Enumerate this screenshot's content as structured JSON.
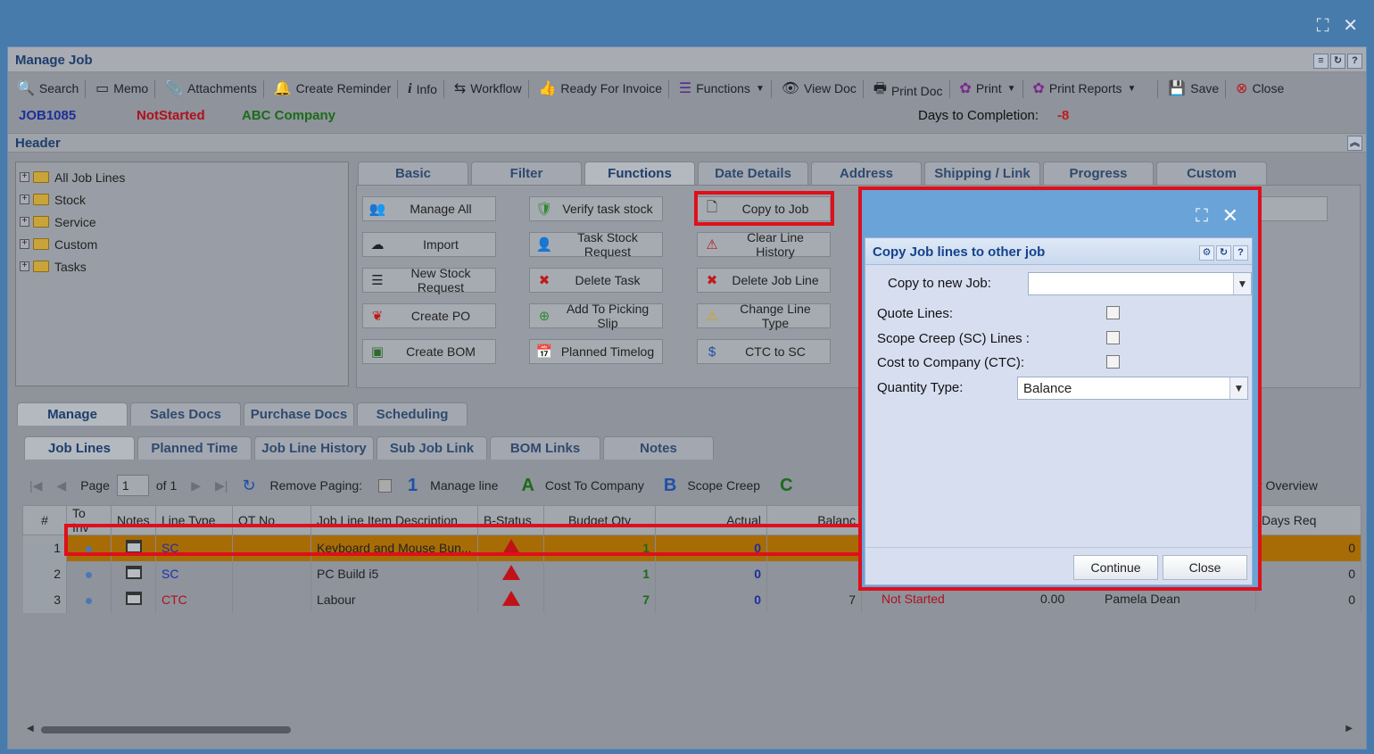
{
  "window": {
    "title": "Manage Job"
  },
  "toolbar": [
    {
      "label": "Search",
      "icon": "search-icon"
    },
    {
      "label": "Memo",
      "icon": "memo-icon"
    },
    {
      "label": "Attachments",
      "icon": "paperclip-icon"
    },
    {
      "label": "Create Reminder",
      "icon": "bell-icon"
    },
    {
      "label": "Info",
      "icon": "info-icon"
    },
    {
      "label": "Workflow",
      "icon": "workflow-icon"
    },
    {
      "label": "Ready For Invoice",
      "icon": "thumbs-up-icon"
    },
    {
      "label": "Functions",
      "icon": "menu-icon",
      "dropdown": true
    },
    {
      "label": "View Doc",
      "icon": "eye-icon"
    },
    {
      "label": "Print Doc",
      "icon": "printer-icon"
    },
    {
      "label": "Print",
      "icon": "print-gear-icon",
      "dropdown": true
    },
    {
      "label": "Print Reports",
      "icon": "print-reports-icon",
      "dropdown": true
    },
    {
      "label": "Save",
      "icon": "floppy-icon"
    },
    {
      "label": "Close",
      "icon": "close-circle-icon"
    }
  ],
  "job": {
    "number": "JOB1085",
    "status": "NotStarted",
    "company": "ABC Company",
    "days_label": "Days to Completion:",
    "days_value": "-8"
  },
  "header": {
    "title": "Header"
  },
  "tree": [
    "All Job Lines",
    "Stock",
    "Service",
    "Custom",
    "Tasks"
  ],
  "top_tabs": [
    "Basic",
    "Filter",
    "Functions",
    "Date Details",
    "Address",
    "Shipping / Link",
    "Progress",
    "Custom"
  ],
  "functions": {
    "manage_all": "Manage All",
    "verify_task_stock": "Verify task stock",
    "copy_to_job": "Copy to Job",
    "import": "Import",
    "task_stock_request": "Task Stock Request",
    "clear_line_history": "Clear Line History",
    "new_stock_request": "New Stock Request",
    "delete_task": "Delete Task",
    "delete_job_line": "Delete Job Line",
    "create_po": "Create PO",
    "add_to_picking_slip": "Add To Picking Slip",
    "change_line_type": "Change Line Type",
    "create_bom": "Create BOM",
    "planned_timelog": "Planned Timelog",
    "ctc_to_sc": "CTC to SC",
    "complete_partial": "mplete"
  },
  "bottom_tabs": [
    "Manage",
    "Sales Docs",
    "Purchase Docs",
    "Scheduling"
  ],
  "sub_tabs": [
    "Job Lines",
    "Planned Time",
    "Job Line History",
    "Sub Job Link",
    "BOM Links",
    "Notes"
  ],
  "pager": {
    "page_label": "Page",
    "page_value": "1",
    "of_label": "of 1",
    "remove_paging": "Remove Paging:",
    "legend": [
      {
        "key": "1",
        "label": "Manage line"
      },
      {
        "key": "A",
        "label": "Cost To Company"
      },
      {
        "key": "B",
        "label": "Scope Creep"
      },
      {
        "key": "C",
        "label": ""
      }
    ],
    "overview_partial": "ry Overview"
  },
  "grid": {
    "columns": [
      "#",
      "To Inv",
      "Notes",
      "Line Type",
      "QT No",
      "Job Line Item Description",
      "B-Status",
      "Budget Qty",
      "Actual",
      "Balanc"
    ],
    "right_column": "Days Req",
    "rows": [
      {
        "n": "1",
        "type": "SC",
        "desc": "Keyboard and Mouse Bun...",
        "budget": "1",
        "actual": "0",
        "days": "0"
      },
      {
        "n": "2",
        "type": "SC",
        "desc": "PC Build i5",
        "budget": "1",
        "actual": "0",
        "days": "0"
      },
      {
        "n": "3",
        "type": "CTC",
        "desc": "Labour",
        "budget": "7",
        "actual": "0",
        "days": "0",
        "partial": {
          "status": "Not Started",
          "amount": "0.00",
          "assignee": "Pamela Dean",
          "balance": "7"
        }
      }
    ]
  },
  "dialog": {
    "title": "Copy Job lines to other job",
    "copy_to_new_job_label": "Copy to new Job:",
    "copy_to_new_job_value": "",
    "quote_lines_label": "Quote Lines:",
    "scope_creep_label": "Scope Creep (SC) Lines :",
    "ctc_label": "Cost to Company (CTC):",
    "quantity_type_label": "Quantity Type:",
    "quantity_type_value": "Balance",
    "continue": "Continue",
    "close": "Close"
  },
  "colors": {
    "accent": "#15428b",
    "highlight_row": "#a86c06",
    "annotation": "#e00f1a"
  }
}
